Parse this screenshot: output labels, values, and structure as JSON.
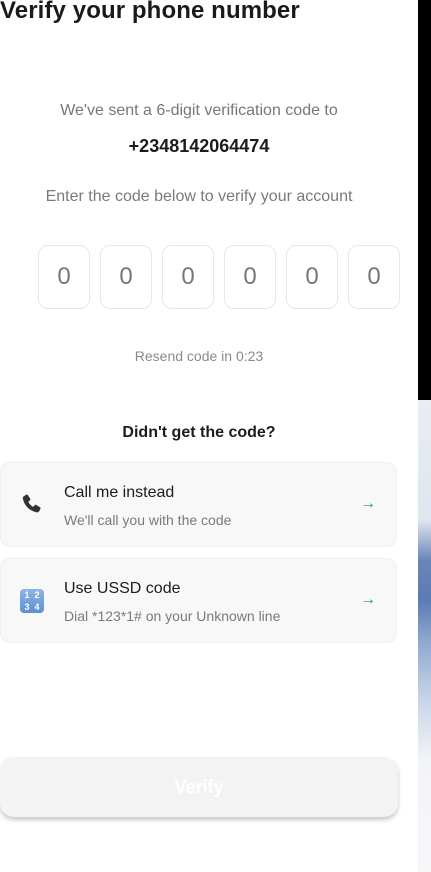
{
  "header": {
    "title": "Verify your phone number"
  },
  "message": {
    "sent_text": "We've sent a 6-digit verification code to",
    "phone_number": "+2348142064474",
    "enter_text": "Enter the code below to verify your account"
  },
  "code": {
    "digits": [
      "0",
      "0",
      "0",
      "0",
      "0",
      "0"
    ]
  },
  "resend": {
    "text": "Resend code in 0:23"
  },
  "alternatives": {
    "heading": "Didn't get the code?",
    "options": [
      {
        "title": "Call me instead",
        "subtitle": "We'll call you with the code",
        "icon": "phone-icon",
        "arrow": "→"
      },
      {
        "title": "Use USSD code",
        "subtitle": "Dial *123*1# on your Unknown line",
        "icon": "keypad-icon",
        "keypad_digits": [
          "1",
          "2",
          "3",
          "4"
        ],
        "arrow": "→"
      }
    ]
  },
  "footer": {
    "verify_label": "Verify"
  },
  "colors": {
    "accent_arrow": "#1aa34a",
    "button_background": "#f3f3f3",
    "button_text": "#ffffff"
  }
}
